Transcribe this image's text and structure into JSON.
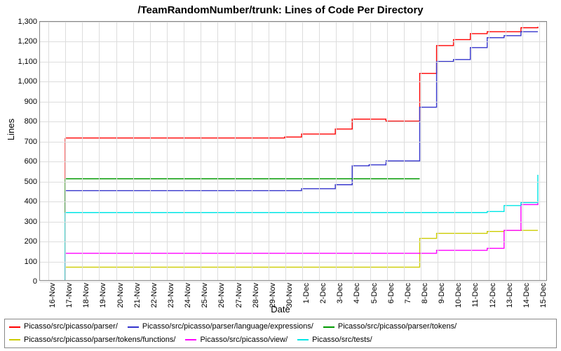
{
  "chart_data": {
    "type": "line",
    "title": "/TeamRandomNumber/trunk: Lines of Code Per Directory",
    "xlabel": "Date",
    "ylabel": "Lines",
    "ylim": [
      0,
      1300
    ],
    "yticks": [
      0,
      100,
      200,
      300,
      400,
      500,
      600,
      700,
      800,
      900,
      1000,
      1100,
      1200,
      1300
    ],
    "ytick_labels": [
      "0",
      "100",
      "200",
      "300",
      "400",
      "500",
      "600",
      "700",
      "800",
      "900",
      "1,000",
      "1,100",
      "1,200",
      "1,300"
    ],
    "x_categories": [
      "16-Nov",
      "17-Nov",
      "18-Nov",
      "19-Nov",
      "20-Nov",
      "21-Nov",
      "22-Nov",
      "23-Nov",
      "24-Nov",
      "25-Nov",
      "26-Nov",
      "27-Nov",
      "28-Nov",
      "29-Nov",
      "30-Nov",
      "1-Dec",
      "2-Dec",
      "3-Dec",
      "4-Dec",
      "5-Dec",
      "6-Dec",
      "7-Dec",
      "8-Dec",
      "9-Dec",
      "10-Dec",
      "11-Dec",
      "12-Dec",
      "13-Dec",
      "14-Dec",
      "15-Dec"
    ],
    "series": [
      {
        "name": "Picasso/src/picasso/parser/",
        "color": "#ff0000",
        "values": [
          null,
          715,
          715,
          715,
          715,
          715,
          715,
          715,
          715,
          715,
          715,
          715,
          715,
          715,
          720,
          735,
          735,
          760,
          810,
          810,
          800,
          800,
          1040,
          1180,
          1210,
          1240,
          1250,
          1250,
          1270,
          1275
        ]
      },
      {
        "name": "Picasso/src/picasso/parser/language/expressions/",
        "color": "#3333cc",
        "values": [
          null,
          450,
          450,
          450,
          450,
          450,
          450,
          450,
          450,
          450,
          450,
          450,
          450,
          450,
          450,
          460,
          460,
          480,
          575,
          580,
          600,
          600,
          870,
          1100,
          1110,
          1170,
          1220,
          1230,
          1250,
          1250
        ]
      },
      {
        "name": "Picasso/src/picasso/parser/tokens/",
        "color": "#009900",
        "values": [
          null,
          510,
          510,
          510,
          510,
          510,
          510,
          510,
          510,
          510,
          510,
          510,
          510,
          510,
          510,
          510,
          510,
          510,
          510,
          510,
          510,
          510,
          510,
          null,
          null,
          null,
          null,
          null,
          null,
          null
        ]
      },
      {
        "name": "Picasso/src/picasso/parser/tokens/functions/",
        "color": "#cccc00",
        "values": [
          null,
          65,
          65,
          65,
          65,
          65,
          65,
          65,
          65,
          65,
          65,
          65,
          65,
          65,
          65,
          65,
          65,
          65,
          65,
          65,
          65,
          65,
          210,
          235,
          235,
          235,
          245,
          250,
          250,
          250
        ]
      },
      {
        "name": "Picasso/src/picasso/view/",
        "color": "#ff00ff",
        "values": [
          null,
          135,
          135,
          135,
          135,
          135,
          135,
          135,
          135,
          135,
          135,
          135,
          135,
          135,
          135,
          135,
          135,
          135,
          135,
          135,
          135,
          135,
          135,
          150,
          150,
          150,
          160,
          250,
          380,
          390
        ]
      },
      {
        "name": "Picasso/src/tests/",
        "color": "#00e6e6",
        "values": [
          null,
          340,
          340,
          340,
          340,
          340,
          340,
          340,
          340,
          340,
          340,
          340,
          340,
          340,
          340,
          340,
          340,
          340,
          340,
          340,
          340,
          340,
          340,
          340,
          340,
          340,
          345,
          375,
          390,
          530
        ]
      }
    ]
  }
}
